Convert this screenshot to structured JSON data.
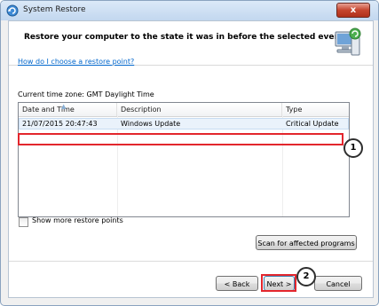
{
  "window": {
    "title": "System Restore",
    "close_glyph": "x"
  },
  "header": {
    "heading": "Restore your computer to the state it was in before the selected event"
  },
  "help_link": "How do I choose a restore point?",
  "timezone_label": "Current time zone: GMT Daylight Time",
  "table": {
    "columns": [
      "Date and Time",
      "Description",
      "Type"
    ],
    "rows": [
      {
        "date": "21/07/2015 20:47:43",
        "description": "Windows Update",
        "type": "Critical Update"
      }
    ]
  },
  "show_more_label": "Show more restore points",
  "scan_button": "Scan for affected programs",
  "buttons": {
    "back": "< Back",
    "next": "Next >",
    "cancel": "Cancel"
  },
  "annotations": {
    "badge_1": "1",
    "badge_2": "2"
  },
  "colors": {
    "annotation_red": "#e3262d",
    "link_blue": "#0066cc",
    "selection": "#eaf2fb"
  }
}
